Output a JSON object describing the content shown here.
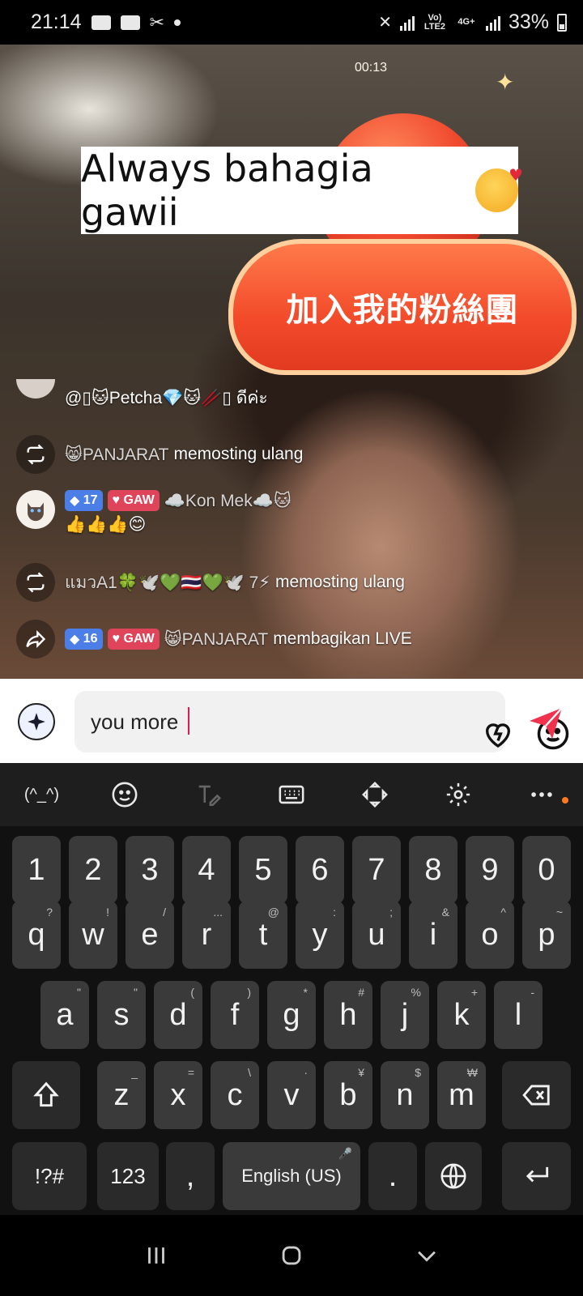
{
  "status_bar": {
    "time": "21:14",
    "network_label_top": "Vo) LTE2",
    "network_label_type": "4G+",
    "battery": "33%"
  },
  "live": {
    "timer": "00:13",
    "caption": "Always bahagia gawii",
    "fan_banner": "加入我的粉絲團",
    "comments": [
      {
        "type": "comment",
        "avatar": "partial-avatar",
        "name": "",
        "text": "@▯🐱Petcha💎🐱🥢▯ ดีค่ะ"
      },
      {
        "type": "repost",
        "icon": "repost-icon",
        "name": "😸PANJARAT",
        "text": "memosting ulang"
      },
      {
        "type": "comment",
        "avatar": "cat-avatar",
        "level": "17",
        "fan_badge": "GAW",
        "name": "☁️Kon Mek☁️🐱",
        "text": "👍👍👍😊"
      },
      {
        "type": "repost",
        "icon": "repost-icon",
        "name": "แมวA1🍀🕊️💚🇹🇭💚🕊️ 7⚡",
        "text": "memosting ulang"
      },
      {
        "type": "share",
        "icon": "share-icon",
        "level": "16",
        "fan_badge": "GAW",
        "name": "😸PANJARAT",
        "text": "membagikan LIVE"
      }
    ]
  },
  "composer": {
    "input_value": "you more",
    "icons": [
      "sparkle-ai-icon",
      "heart-outline-icon",
      "emoji-icon",
      "send-icon"
    ]
  },
  "keyboard": {
    "toolbar": [
      "(^_^)",
      "emoji-icon",
      "handwriting-icon",
      "keyboard-icon",
      "cursor-move-icon",
      "settings-gear-icon",
      "more-icon"
    ],
    "row_numbers": [
      "1",
      "2",
      "3",
      "4",
      "5",
      "6",
      "7",
      "8",
      "9",
      "0"
    ],
    "row1": [
      {
        "k": "q",
        "s": "?"
      },
      {
        "k": "w",
        "s": "!"
      },
      {
        "k": "e",
        "s": "/"
      },
      {
        "k": "r",
        "s": "..."
      },
      {
        "k": "t",
        "s": "@"
      },
      {
        "k": "y",
        "s": ":"
      },
      {
        "k": "u",
        "s": ";"
      },
      {
        "k": "i",
        "s": "&"
      },
      {
        "k": "o",
        "s": "^"
      },
      {
        "k": "p",
        "s": "~"
      }
    ],
    "row2": [
      {
        "k": "a",
        "s": "\""
      },
      {
        "k": "s",
        "s": "\""
      },
      {
        "k": "d",
        "s": "("
      },
      {
        "k": "f",
        "s": ")"
      },
      {
        "k": "g",
        "s": "*"
      },
      {
        "k": "h",
        "s": "#"
      },
      {
        "k": "j",
        "s": "%"
      },
      {
        "k": "k",
        "s": "+"
      },
      {
        "k": "l",
        "s": "-"
      }
    ],
    "row3": [
      {
        "k": "z",
        "s": "_"
      },
      {
        "k": "x",
        "s": "="
      },
      {
        "k": "c",
        "s": "\\"
      },
      {
        "k": "v",
        "s": "·"
      },
      {
        "k": "b",
        "s": "¥"
      },
      {
        "k": "n",
        "s": "$"
      },
      {
        "k": "m",
        "s": "₩"
      }
    ],
    "symbols_key": "!?#",
    "numbers_key": "123",
    "comma_key": ",",
    "space_key": "English (US)",
    "period_key": "."
  },
  "colors": {
    "accent_send": "#f0324e",
    "level_badge": "#4c7ee8",
    "fan_badge": "#e0445a",
    "keyboard_key": "#3a3a3a",
    "keyboard_bg": "#111111"
  }
}
